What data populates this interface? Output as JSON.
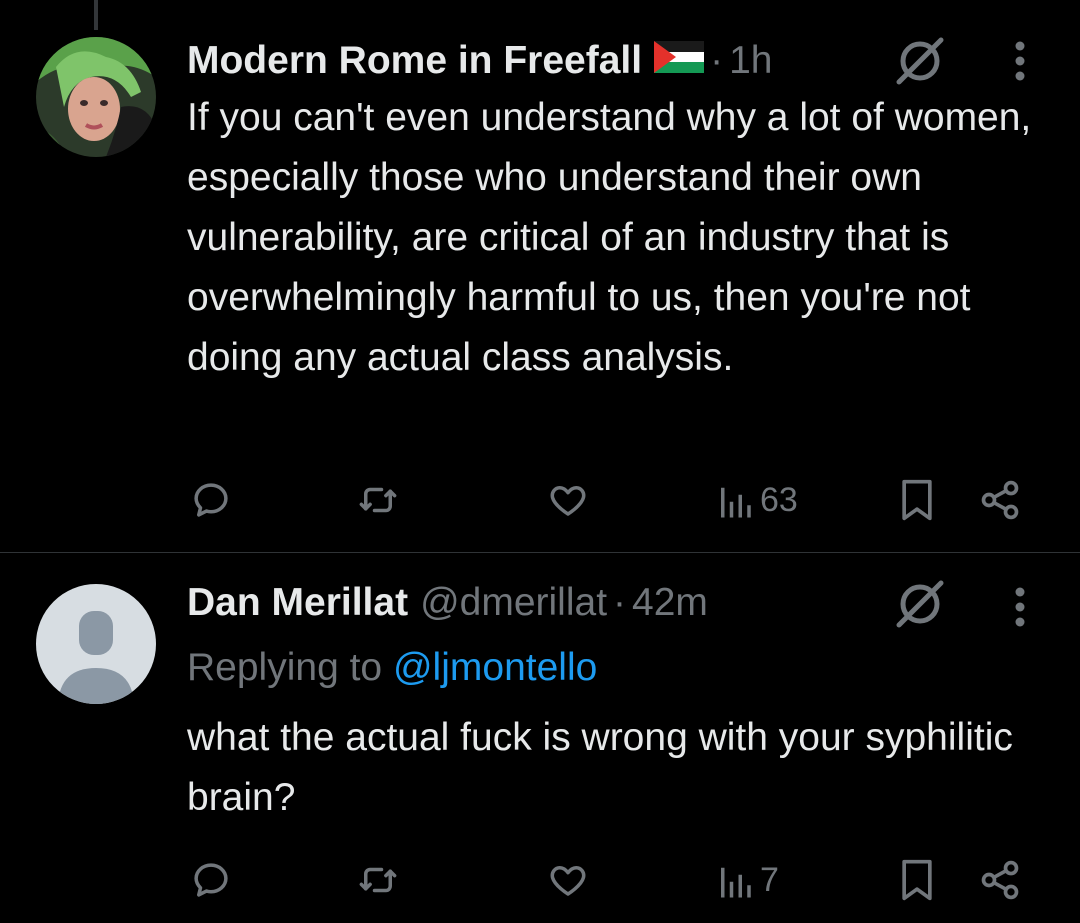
{
  "colors": {
    "background": "#000000",
    "text": "#e7e9ea",
    "muted": "#71767b",
    "link": "#1d9bf0",
    "divider": "#2f3336"
  },
  "tweets": [
    {
      "display_name": "Modern Rome in Freefall",
      "flag_icon": "palestine-flag-icon",
      "handle": "",
      "separator": "·",
      "time": "1h",
      "replying_to_label": "",
      "replying_to_handle": "",
      "text": "If you can't even understand why a lot of women, especially those who understand their own vulnerability, are critical of an industry that is overwhelmingly harmful to us, then you're not doing any actual class analysis.",
      "views": "63",
      "avatar": "profile-photo"
    },
    {
      "display_name": "Dan Merillat",
      "flag_icon": "",
      "handle": "@dmerillat",
      "separator": "·",
      "time": "42m",
      "replying_to_label": "Replying to",
      "replying_to_handle": "@ljmontello",
      "text": "what the actual fuck is wrong with your syphilitic brain?",
      "views": "7",
      "avatar": "default-avatar"
    }
  ]
}
